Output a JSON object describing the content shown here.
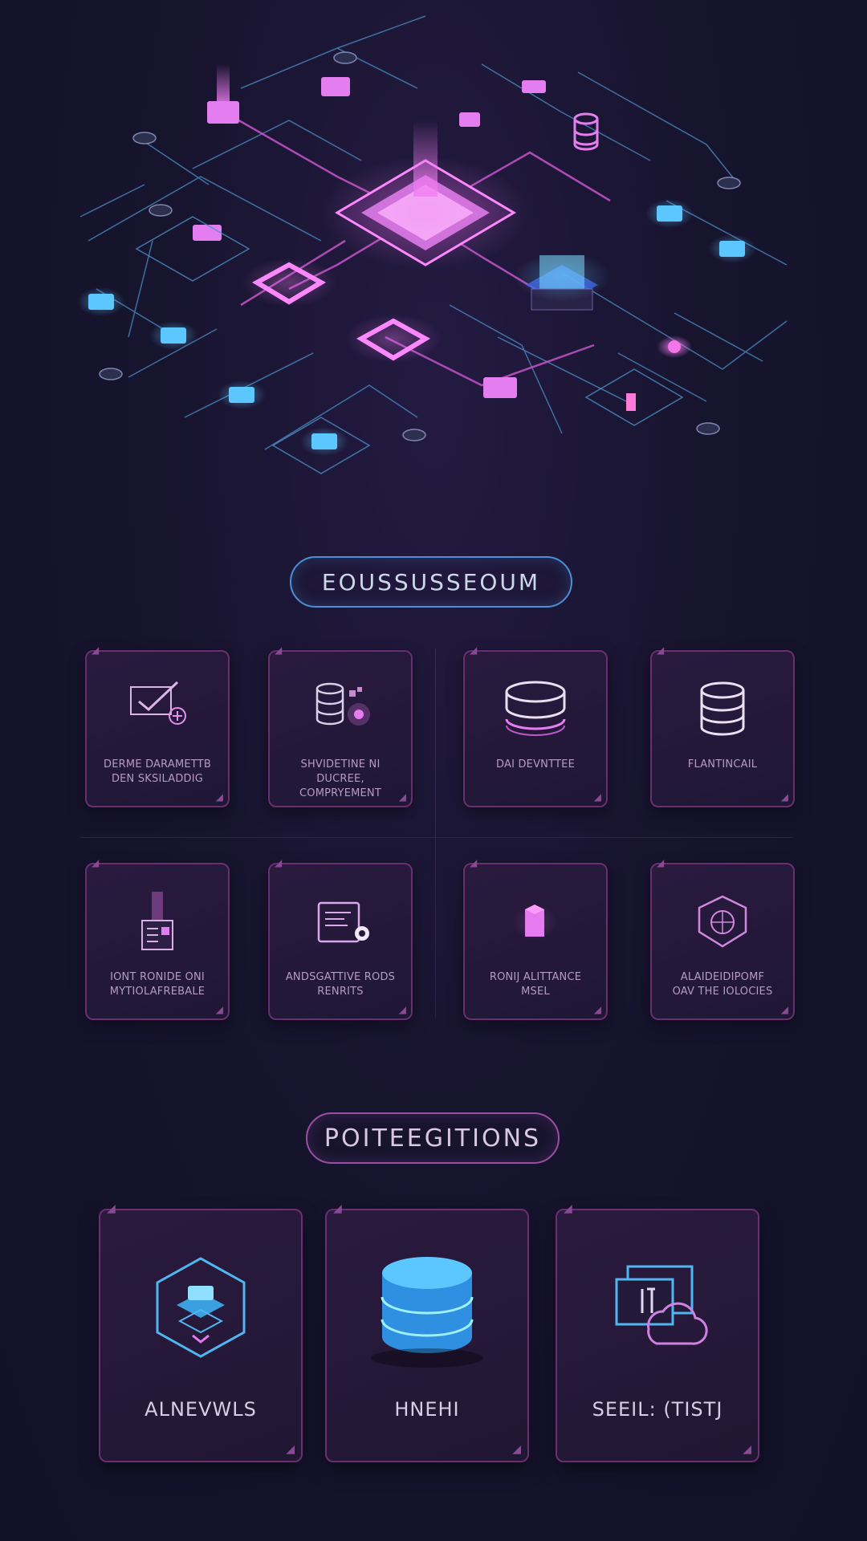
{
  "section_one": {
    "title": "EOUSSUSSEOUM",
    "cards": [
      {
        "label_line1": "DERME DARAMETTB",
        "label_line2": "DEN SKSILADDIG",
        "icon": "pen-check-icon"
      },
      {
        "label_line1": "SHVIDETINE NI DUCREE,",
        "label_line2": "COMPRYEMENT",
        "icon": "database-cluster-icon"
      },
      {
        "label_line1": "DAI DEVNTTEE",
        "label_line2": "",
        "icon": "database-icon"
      },
      {
        "label_line1": "FLANTINCAIL",
        "label_line2": "",
        "icon": "database-stack-icon"
      },
      {
        "label_line1": "IONT RONIDE ONI",
        "label_line2": "MYTIOLAFREBALE",
        "icon": "glowing-box-icon"
      },
      {
        "label_line1": "ANDSGATTIVE RODS",
        "label_line2": "RENRITS",
        "icon": "document-icon"
      },
      {
        "label_line1": "RONIJ ALITTANCE",
        "label_line2": "MSEL",
        "icon": "cube-icon"
      },
      {
        "label_line1": "ALAIDEIDIPOMF",
        "label_line2": "OAV THE IOLOCIES",
        "icon": "shield-network-icon"
      }
    ]
  },
  "section_two": {
    "title": "POITEEGITIONS",
    "cards": [
      {
        "label": "ALNEVWLS",
        "icon": "hexagon-stack-icon"
      },
      {
        "label": "HNEHI",
        "icon": "database-cylinder-icon"
      },
      {
        "label": "SEEIL: (TISTJ",
        "icon": "cloud-document-icon"
      }
    ]
  },
  "colors": {
    "background": "#17142e",
    "accent_pink": "#e86ce8",
    "accent_blue": "#4fb6f0",
    "card_border": "#6a2f70"
  }
}
